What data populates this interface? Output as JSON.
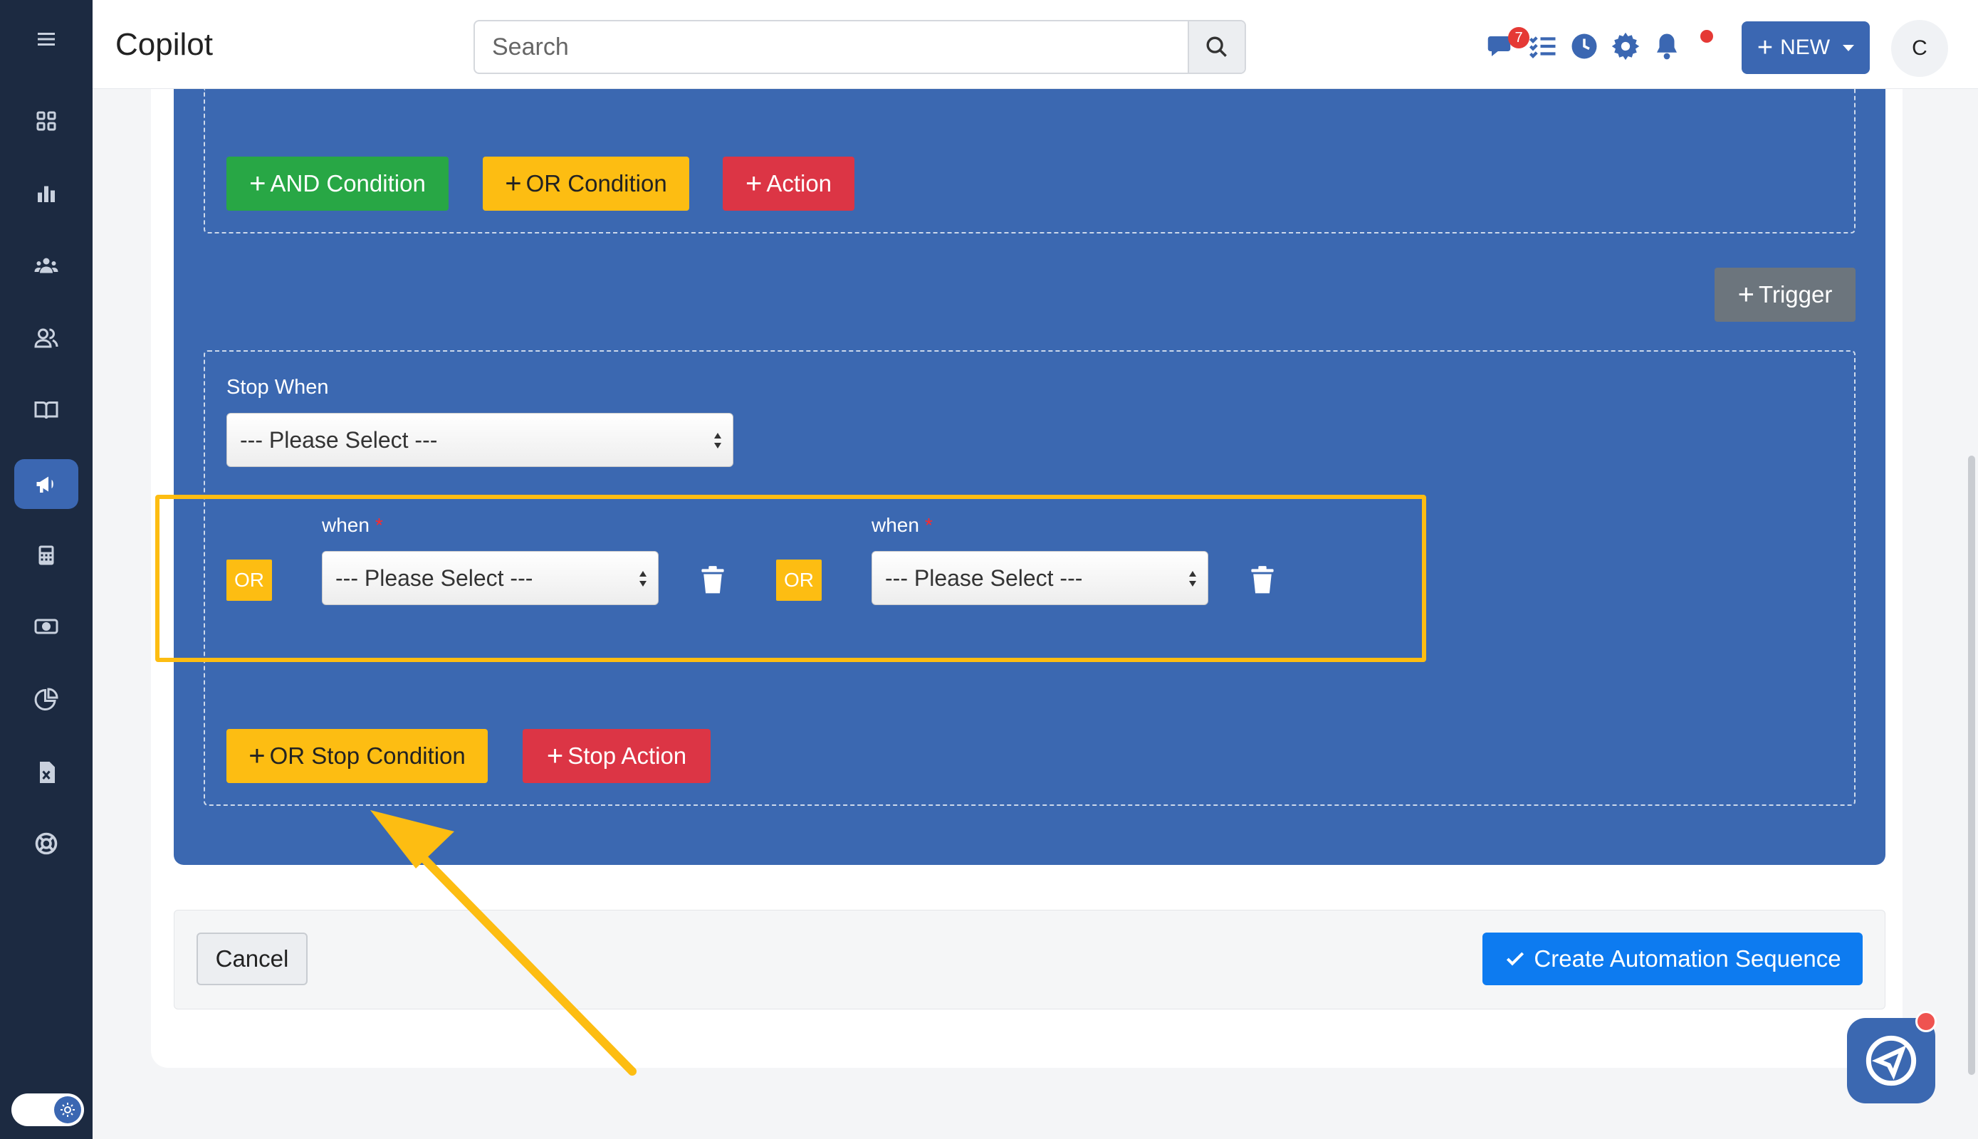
{
  "header": {
    "title": "Copilot",
    "search_placeholder": "Search",
    "chat_badge": "7",
    "new_label": "NEW",
    "avatar_letter": "C"
  },
  "sidebar": {
    "icons": [
      "menu-icon",
      "dashboard-icon",
      "chart-icon",
      "team-icon",
      "users-icon",
      "book-icon",
      "megaphone-icon",
      "calculator-icon",
      "money-icon",
      "pie-icon",
      "excel-icon",
      "support-icon"
    ],
    "active": "megaphone-icon"
  },
  "conditions": {
    "and_condition_label": "AND Condition",
    "or_condition_label": "OR Condition",
    "action_label": "Action",
    "trigger_label": "Trigger"
  },
  "stop": {
    "title": "Stop When",
    "select_placeholder": "--- Please Select ---",
    "rows": [
      {
        "or": "OR",
        "label": "when",
        "value": "--- Please Select ---"
      },
      {
        "or": "OR",
        "label": "when",
        "value": "--- Please Select ---"
      }
    ],
    "or_stop_label": "OR Stop Condition",
    "stop_action_label": "Stop Action"
  },
  "footer": {
    "cancel_label": "Cancel",
    "create_label": "Create Automation Sequence"
  },
  "colors": {
    "sidebar": "#1c2a41",
    "panel": "#3b68b1",
    "highlight": "#fdbd12",
    "green": "#28a745",
    "red": "#dc3545",
    "primary": "#0d7bf0"
  }
}
